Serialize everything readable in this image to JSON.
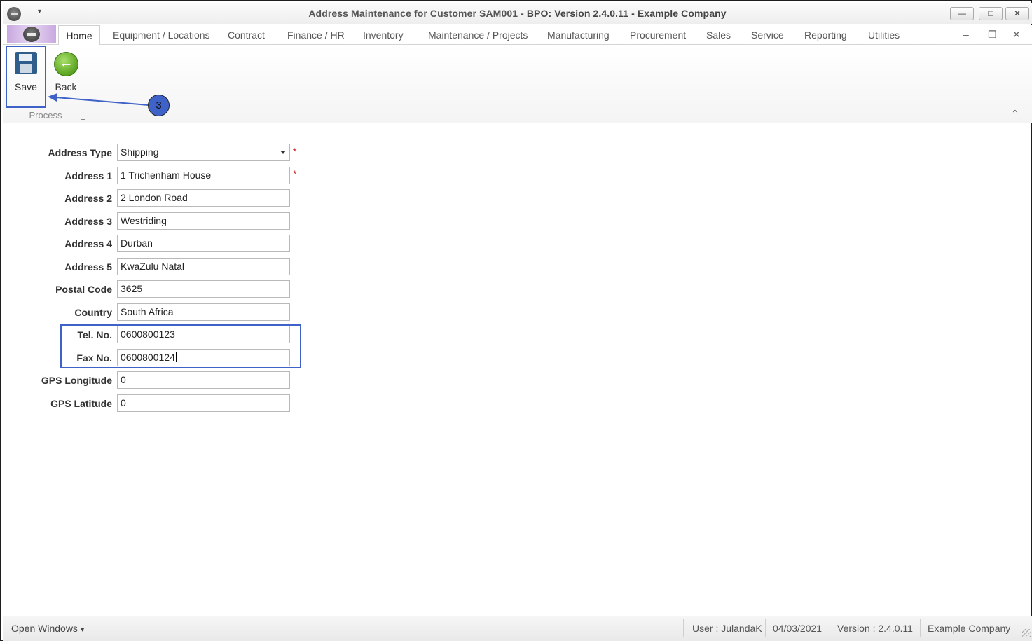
{
  "window": {
    "title_prefix": "Address Maintenance for Customer SAM001 - ",
    "title_app": "BPO: Version 2.4.0.11 - Example Company",
    "minimize_icon": "—",
    "maximize_icon": "□",
    "close_icon": "✕",
    "qat_arrow": "▾"
  },
  "ribbon": {
    "tabs": [
      "Home",
      "Equipment / Locations",
      "Contract",
      "Finance / HR",
      "Inventory",
      "Maintenance / Projects",
      "Manufacturing",
      "Procurement",
      "Sales",
      "Service",
      "Reporting",
      "Utilities"
    ],
    "active_tab": "Home",
    "mdi_minimize": "–",
    "mdi_restore": "❐",
    "mdi_close": "✕",
    "collapse_icon": "⌃",
    "buttons": {
      "save": "Save",
      "back": "Back"
    },
    "group_label": "Process"
  },
  "annotation": {
    "step_number": "3",
    "color": "#3f62c8"
  },
  "form": {
    "address_type": {
      "label": "Address Type",
      "value": "Shipping",
      "required": "*"
    },
    "address1": {
      "label": "Address 1",
      "value": "1 Trichenham House",
      "required": "*"
    },
    "address2": {
      "label": "Address 2",
      "value": "2 London Road"
    },
    "address3": {
      "label": "Address 3",
      "value": "Westriding"
    },
    "address4": {
      "label": "Address 4",
      "value": "Durban"
    },
    "address5": {
      "label": "Address 5",
      "value": "KwaZulu Natal"
    },
    "postal_code": {
      "label": "Postal Code",
      "value": "3625"
    },
    "country": {
      "label": "Country",
      "value": "South Africa"
    },
    "tel_no": {
      "label": "Tel. No.",
      "value": "0600800123"
    },
    "fax_no": {
      "label": "Fax No.",
      "value": "0600800124"
    },
    "gps_longitude": {
      "label": "GPS Longitude",
      "value": "0"
    },
    "gps_latitude": {
      "label": "GPS Latitude",
      "value": "0"
    }
  },
  "statusbar": {
    "open_windows": "Open Windows",
    "dropdown_icon": "▾",
    "user": "User : JulandaK",
    "date": "04/03/2021",
    "version": "Version : 2.4.0.11",
    "company": "Example Company"
  }
}
